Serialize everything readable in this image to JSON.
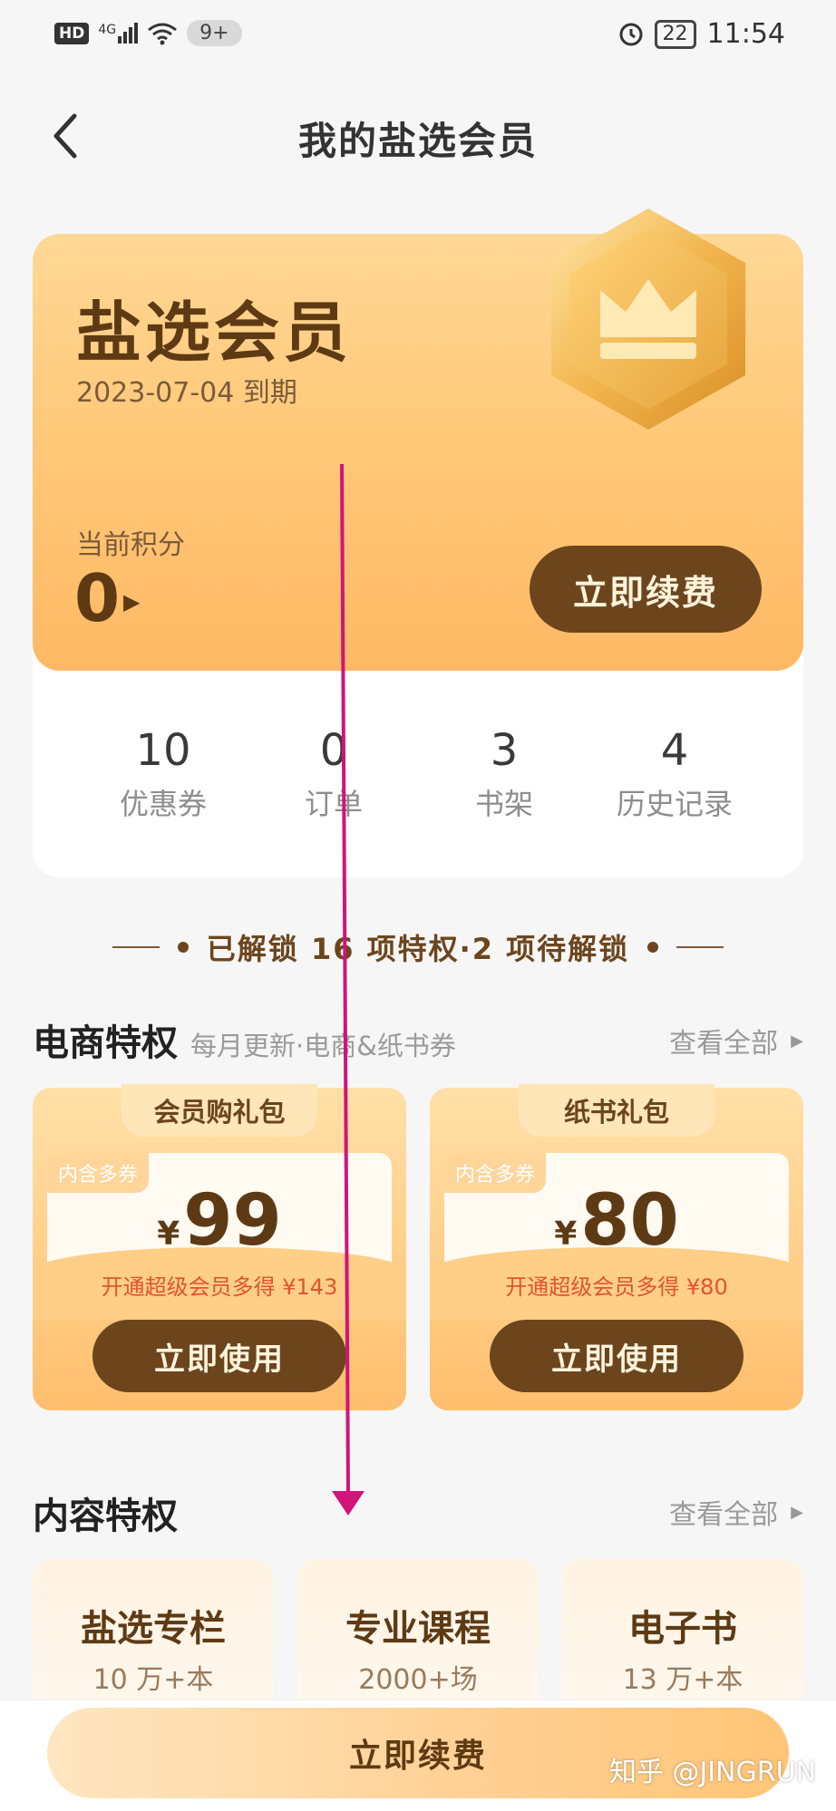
{
  "status_bar": {
    "left_icons": [
      "hd-icon",
      "signal-icon",
      "wifi-icon"
    ],
    "network_label": "4G",
    "hd_label": "HD",
    "notification_badge": "9+",
    "battery": "22",
    "time": "11:54"
  },
  "header": {
    "title": "我的盐选会员",
    "back_icon": "chevron-left-icon"
  },
  "member_card": {
    "title": "盐选会员",
    "expiry": "2023-07-04 到期",
    "points_label": "当前积分",
    "points_value": "0",
    "renew_label": "立即续费",
    "badge_icon": "crown-icon"
  },
  "stats": [
    {
      "value": "10",
      "label": "优惠券"
    },
    {
      "value": "0",
      "label": "订单"
    },
    {
      "value": "3",
      "label": "书架"
    },
    {
      "value": "4",
      "label": "历史记录"
    }
  ],
  "unlock_summary": "已解锁 16 项特权·2 项待解锁",
  "ecommerce": {
    "title": "电商特权",
    "subtitle": "每月更新·电商&纸书券",
    "view_all": "查看全部",
    "cards": [
      {
        "tab": "会员购礼包",
        "tag": "内含多券",
        "currency": "¥",
        "amount": "99",
        "note": "开通超级会员多得 ¥143",
        "button": "立即使用"
      },
      {
        "tab": "纸书礼包",
        "tag": "内含多券",
        "currency": "¥",
        "amount": "80",
        "note": "开通超级会员多得 ¥80",
        "button": "立即使用"
      }
    ]
  },
  "content": {
    "title": "内容特权",
    "view_all": "查看全部",
    "cards": [
      {
        "title": "盐选专栏",
        "sub": "10 万+本"
      },
      {
        "title": "专业课程",
        "sub": "2000+场"
      },
      {
        "title": "电子书",
        "sub": "13 万+本"
      }
    ]
  },
  "bottom_bar": {
    "renew_label": "立即续费"
  },
  "watermark": "知乎 @JINGRUN",
  "colors": {
    "brand_brown": "#6d451d",
    "card_gold": "#ffc97a",
    "annotation_arrow": "#d0147a",
    "price_note_red": "#e0542e"
  }
}
